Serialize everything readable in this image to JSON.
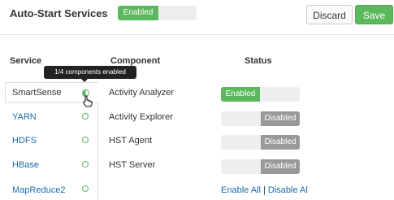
{
  "header": {
    "title": "Auto-Start Services",
    "master_toggle": {
      "on_label": "Enabled",
      "state": "on"
    },
    "discard_label": "Discard",
    "save_label": "Save"
  },
  "columns": {
    "service": "Service",
    "component": "Component",
    "status": "Status"
  },
  "tooltip": "1/4 components enabled",
  "services": [
    {
      "label": "SmartSense",
      "selected": true,
      "indicator": "half-filled-circle-icon"
    },
    {
      "label": "YARN",
      "selected": false,
      "indicator": "circle-outline-icon"
    },
    {
      "label": "HDFS",
      "selected": false,
      "indicator": "circle-outline-icon"
    },
    {
      "label": "HBase",
      "selected": false,
      "indicator": "circle-outline-icon"
    },
    {
      "label": "MapReduce2",
      "selected": false,
      "indicator": "circle-outline-icon"
    }
  ],
  "components": [
    {
      "name": "Activity Analyzer",
      "status": "Enabled"
    },
    {
      "name": "Activity Explorer",
      "status": "Disabled"
    },
    {
      "name": "HST Agent",
      "status": "Disabled"
    },
    {
      "name": "HST Server",
      "status": "Disabled"
    }
  ],
  "bulk": {
    "enable_all": "Enable All",
    "separator": "|",
    "disable_all": "Disable Al"
  },
  "colors": {
    "enabled": "#5cb85c",
    "disabled": "#999999",
    "link": "#1a6ea8"
  }
}
